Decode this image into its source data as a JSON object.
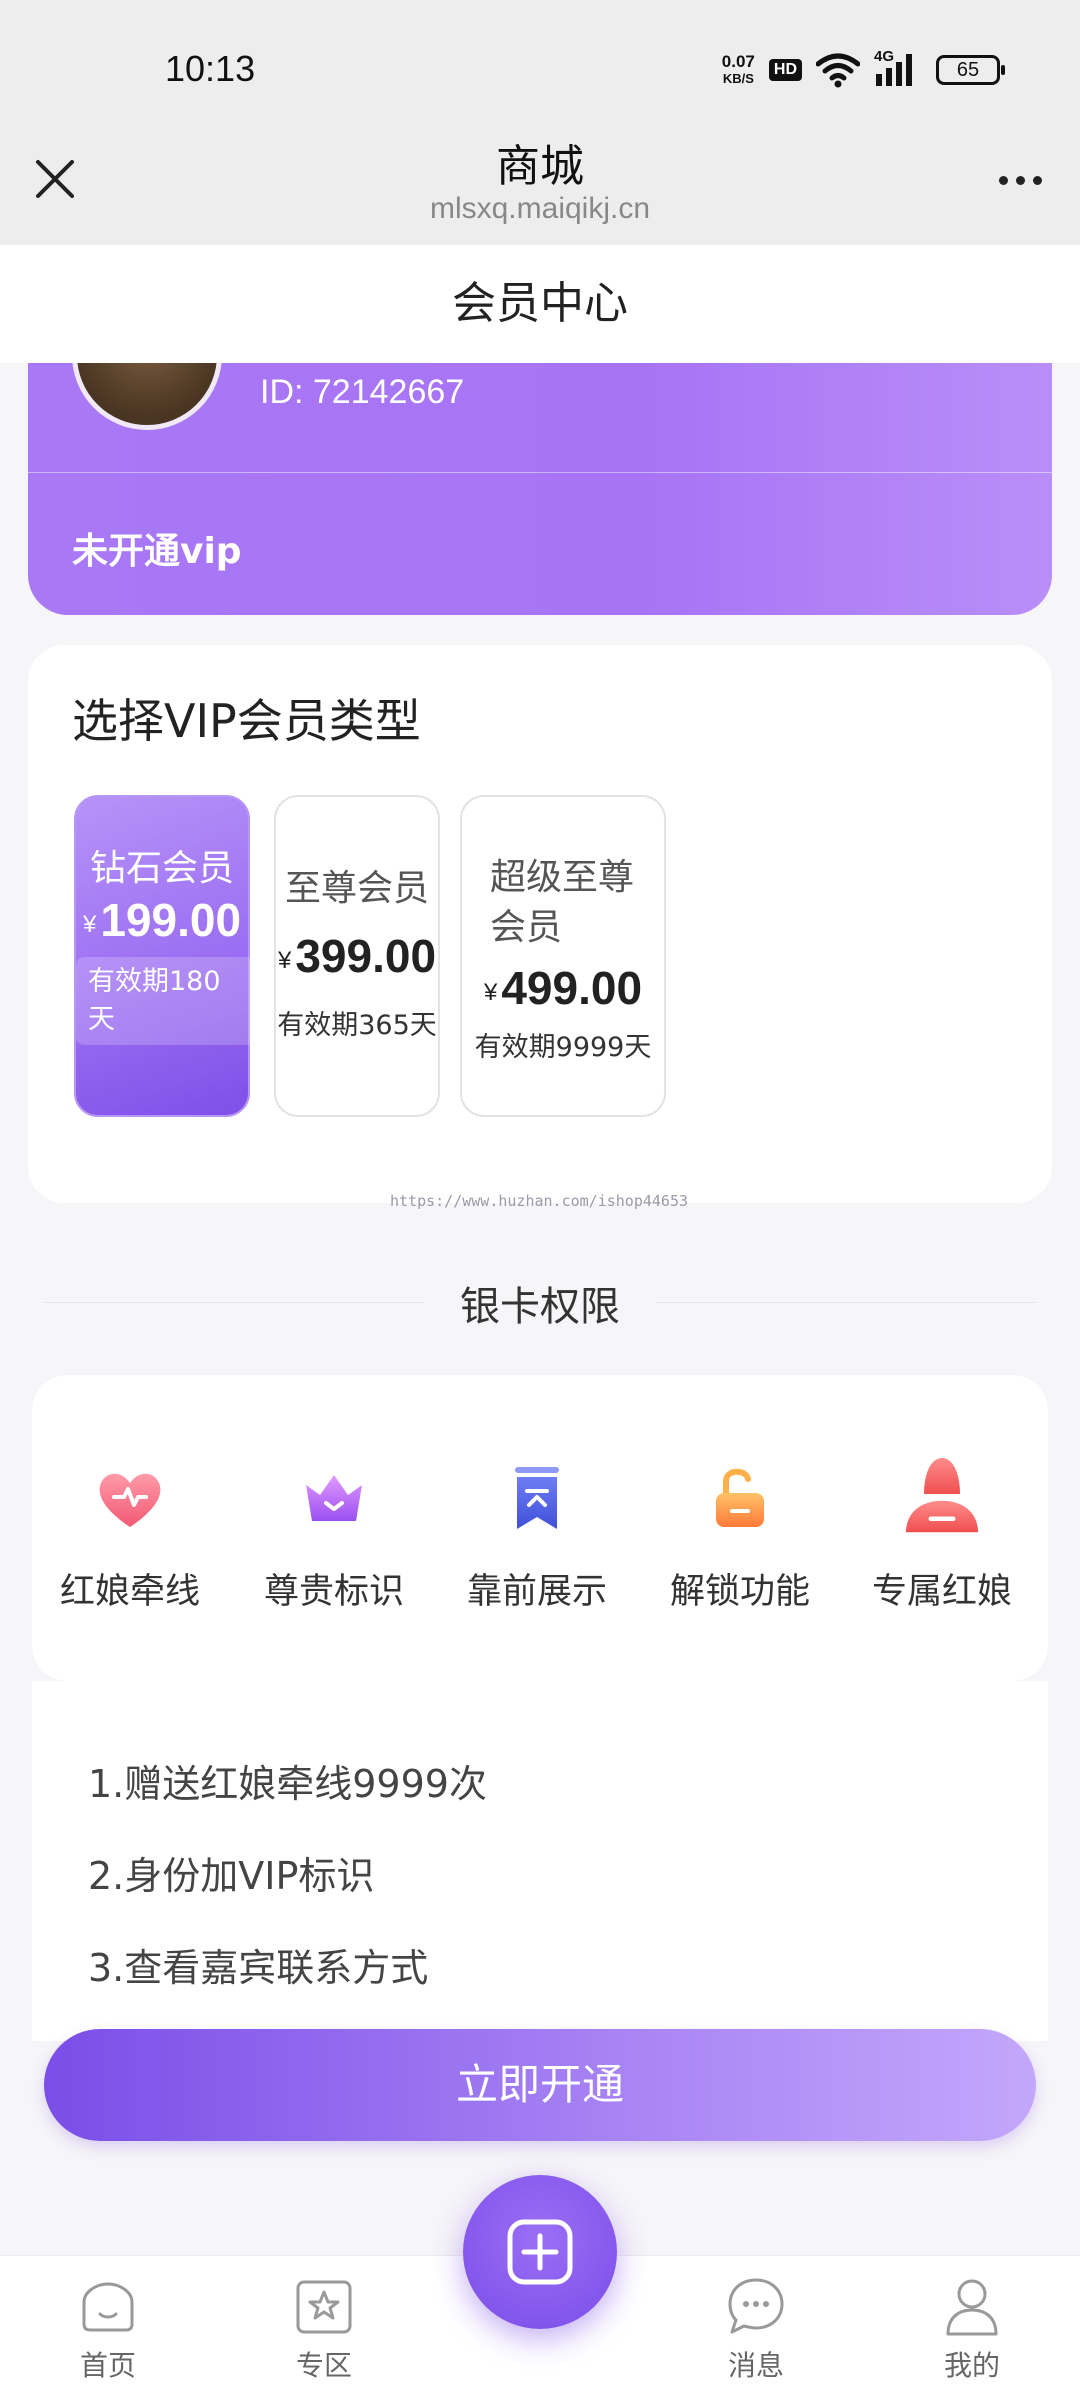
{
  "status_bar": {
    "time": "10:13",
    "net_speed_value": "0.07",
    "net_speed_unit": "KB/S",
    "hd": "HD",
    "network": "4G",
    "battery": "65"
  },
  "browser": {
    "title": "商城",
    "url": "mlsxq.maiqikj.cn"
  },
  "page": {
    "title": "会员中心"
  },
  "profile": {
    "id_text": "ID: 72142667",
    "vip_status": "未开通vip"
  },
  "vip_select": {
    "title": "选择VIP会员类型",
    "currency": "¥",
    "plans": [
      {
        "name": "钻石会员",
        "price": "199.00",
        "validity": "有效期180天",
        "selected": true
      },
      {
        "name": "至尊会员",
        "price": "399.00",
        "validity": "有效期365天",
        "selected": false
      },
      {
        "name": "超级至尊会员",
        "price": "499.00",
        "validity": "有效期9999天",
        "selected": false
      }
    ]
  },
  "watermark": "https://www.huzhan.com/ishop44653",
  "privileges": {
    "title": "银卡权限",
    "items": [
      {
        "label": "红娘牵线",
        "icon": "heart-icon"
      },
      {
        "label": "尊贵标识",
        "icon": "crown-icon"
      },
      {
        "label": "靠前展示",
        "icon": "bookmark-top-icon"
      },
      {
        "label": "解锁功能",
        "icon": "unlock-icon"
      },
      {
        "label": "专属红娘",
        "icon": "matchmaker-icon"
      }
    ]
  },
  "benefits": [
    "1.赠送红娘牵线9999次",
    "2.身份加VIP标识",
    "3.查看嘉宾联系方式"
  ],
  "activate_button": "立即开通",
  "bottom_nav": {
    "items": [
      {
        "label": "首页",
        "icon": "home-icon"
      },
      {
        "label": "专区",
        "icon": "star-zone-icon"
      },
      {
        "label": "消息",
        "icon": "message-icon"
      },
      {
        "label": "我的",
        "icon": "profile-icon"
      }
    ]
  },
  "colors": {
    "accent": "#9c6ef2",
    "accent_dark": "#7a4ee8"
  }
}
